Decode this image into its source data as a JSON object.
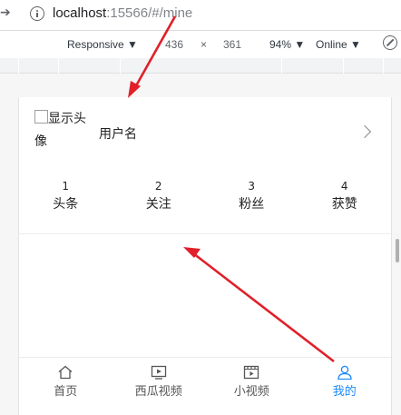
{
  "browser": {
    "url_host": "localhost",
    "url_rest": ":15566/#/mine"
  },
  "devtools": {
    "device": "Responsive",
    "width": "436",
    "times": "×",
    "height": "361",
    "zoom": "94%",
    "network": "Online"
  },
  "profile": {
    "avatar_alt": "显示头像",
    "username": "用户名"
  },
  "stats": [
    {
      "value": "1",
      "label": "头条"
    },
    {
      "value": "2",
      "label": "关注"
    },
    {
      "value": "3",
      "label": "粉丝"
    },
    {
      "value": "4",
      "label": "获赞"
    }
  ],
  "tabbar": {
    "active": "我的",
    "items": [
      {
        "label": "首页",
        "icon": "home-icon"
      },
      {
        "label": "西瓜视频",
        "icon": "video-play-icon"
      },
      {
        "label": "小视频",
        "icon": "film-icon"
      },
      {
        "label": "我的",
        "icon": "user-icon"
      }
    ]
  },
  "colors": {
    "accent": "#1989fa",
    "annotation_arrow": "#e0202a"
  }
}
